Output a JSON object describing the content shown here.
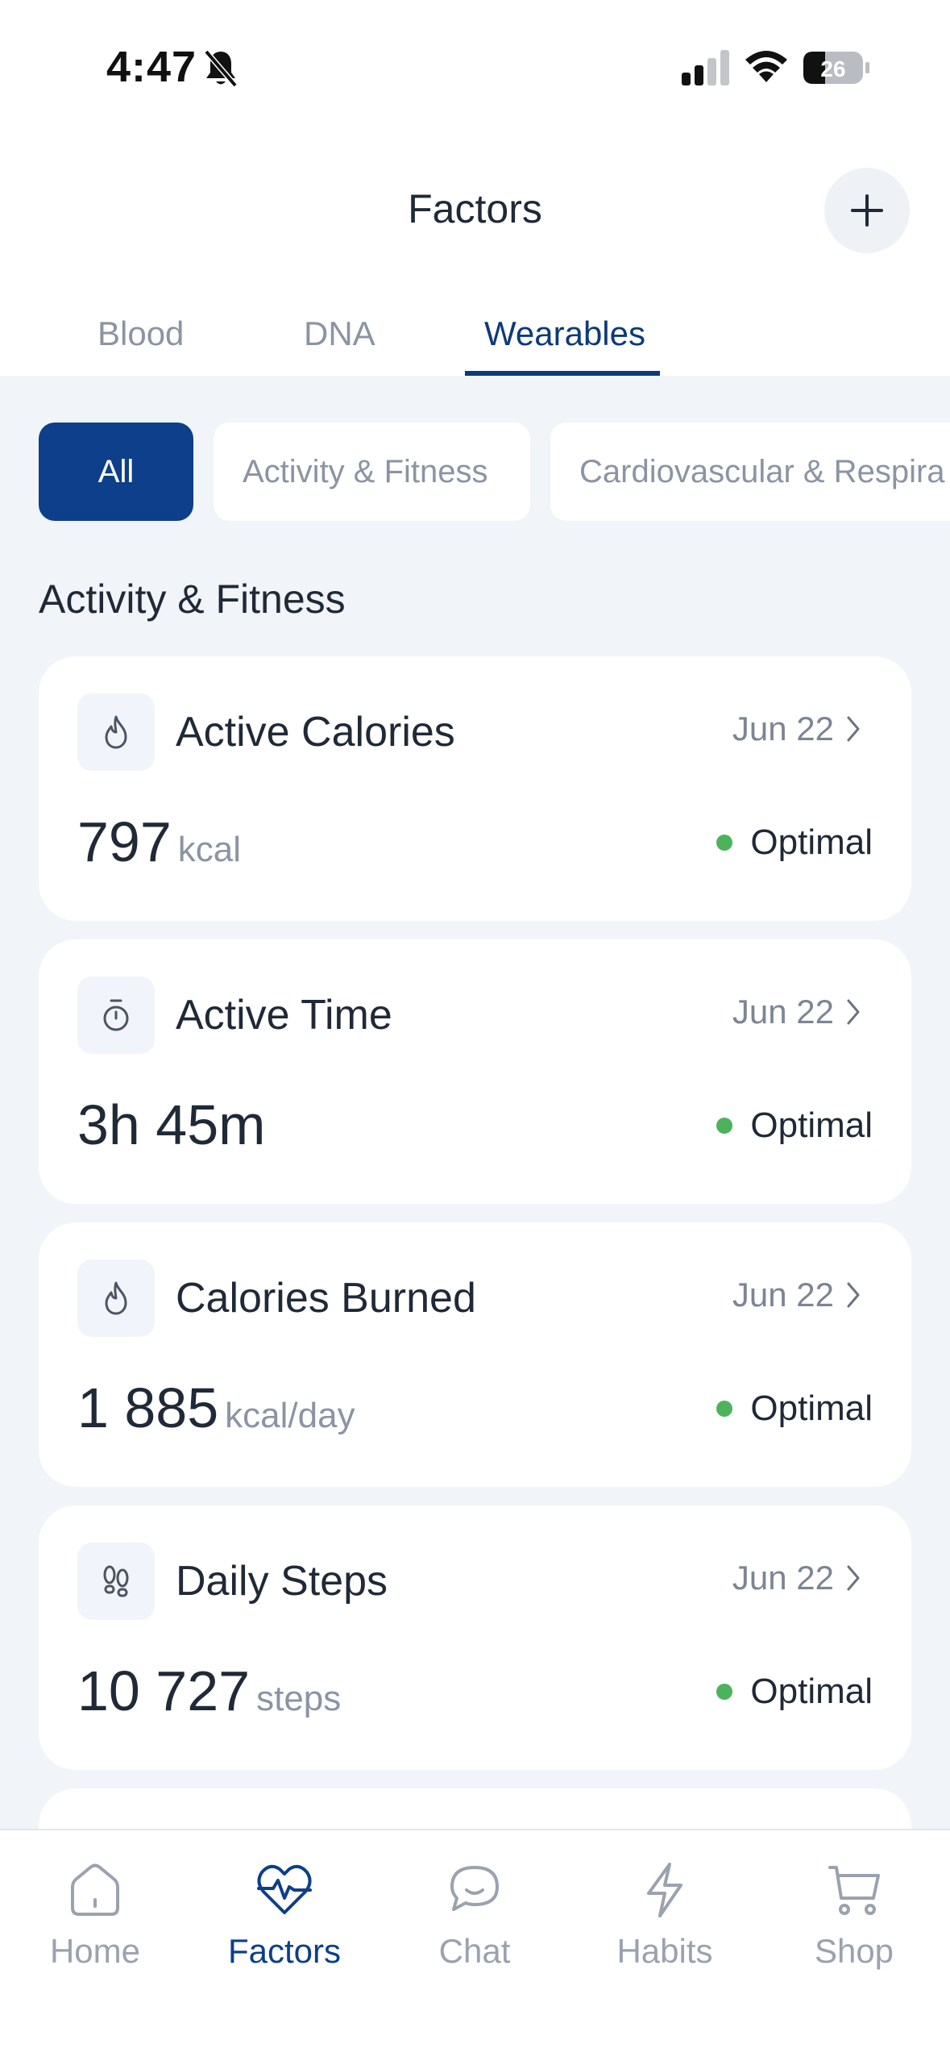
{
  "status_bar": {
    "time": "4:47",
    "battery": "26"
  },
  "header": {
    "title": "Factors"
  },
  "tabs": [
    {
      "label": "Blood"
    },
    {
      "label": "DNA"
    },
    {
      "label": "Wearables"
    }
  ],
  "filters": [
    {
      "label": "All"
    },
    {
      "label": "Activity & Fitness"
    },
    {
      "label": "Cardiovascular & Respira"
    }
  ],
  "section": {
    "title": "Activity & Fitness"
  },
  "cards": [
    {
      "title": "Active Calories",
      "date": "Jun 22",
      "value": "797",
      "unit": "kcal",
      "status": "Optimal",
      "icon": "flame-icon"
    },
    {
      "title": "Active Time",
      "date": "Jun 22",
      "value": "3h 45m",
      "unit": "",
      "status": "Optimal",
      "icon": "stopwatch-icon"
    },
    {
      "title": "Calories Burned",
      "date": "Jun 22",
      "value": "1 885",
      "unit": "kcal/day",
      "status": "Optimal",
      "icon": "flame-icon"
    },
    {
      "title": "Daily Steps",
      "date": "Jun 22",
      "value": "10 727",
      "unit": "steps",
      "status": "Optimal",
      "icon": "footprints-icon"
    }
  ],
  "nav": [
    {
      "label": "Home",
      "icon": "home-icon"
    },
    {
      "label": "Factors",
      "icon": "heart-pulse-icon"
    },
    {
      "label": "Chat",
      "icon": "chat-icon"
    },
    {
      "label": "Habits",
      "icon": "lightning-icon"
    },
    {
      "label": "Shop",
      "icon": "cart-icon"
    }
  ],
  "colors": {
    "accent": "#0d3f8a",
    "optimal": "#4cb35c",
    "background": "#f1f4f8"
  }
}
